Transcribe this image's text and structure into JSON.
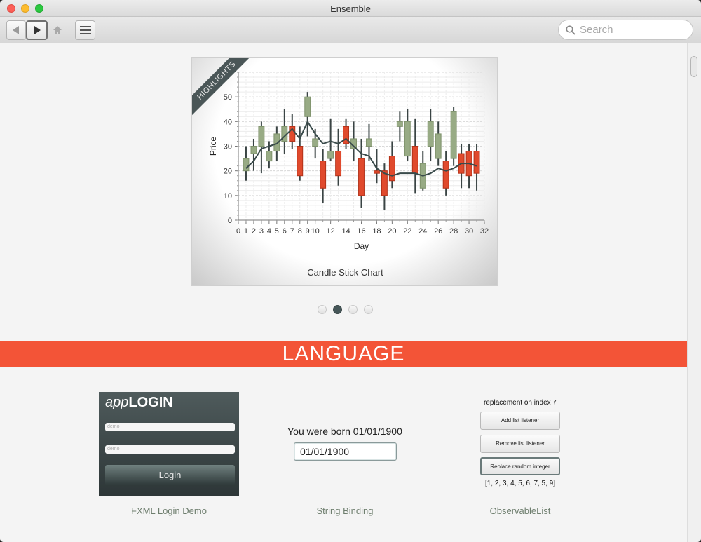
{
  "window": {
    "title": "Ensemble"
  },
  "toolbar": {
    "back_icon": "back-icon",
    "forward_icon": "forward-icon",
    "home_icon": "home-icon",
    "menu_icon": "menu-icon",
    "search_placeholder": "Search"
  },
  "carousel": {
    "ribbon": "HIGHLIGHTS",
    "caption": "Candle Stick Chart",
    "pages": 4,
    "active_page": 2
  },
  "chart_data": {
    "type": "candlestick",
    "xlabel": "Day",
    "ylabel": "Price",
    "xlim": [
      0,
      32
    ],
    "ylim": [
      0,
      60
    ],
    "xticks": [
      0,
      1,
      2,
      3,
      4,
      5,
      6,
      7,
      8,
      9,
      10,
      12,
      14,
      16,
      18,
      20,
      22,
      24,
      26,
      28,
      30,
      32
    ],
    "yticks": [
      0,
      10,
      20,
      30,
      40,
      50
    ],
    "colors": {
      "bull": "#98ab85",
      "bear": "#e04a2d",
      "line": "#3a4b4b"
    },
    "candles": [
      {
        "x": 1,
        "open": 20,
        "close": 25,
        "high": 30,
        "low": 16
      },
      {
        "x": 2,
        "open": 27,
        "close": 30,
        "high": 33,
        "low": 20
      },
      {
        "x": 3,
        "open": 30,
        "close": 38,
        "high": 40,
        "low": 19
      },
      {
        "x": 4,
        "open": 24,
        "close": 28,
        "high": 32,
        "low": 21
      },
      {
        "x": 5,
        "open": 28,
        "close": 35,
        "high": 38,
        "low": 24
      },
      {
        "x": 6,
        "open": 32,
        "close": 38,
        "high": 45,
        "low": 27
      },
      {
        "x": 7,
        "open": 38,
        "close": 32,
        "high": 43,
        "low": 29
      },
      {
        "x": 8,
        "open": 30,
        "close": 18,
        "high": 38,
        "low": 16
      },
      {
        "x": 9,
        "open": 42,
        "close": 50,
        "high": 52,
        "low": 34
      },
      {
        "x": 10,
        "open": 30,
        "close": 33,
        "high": 37,
        "low": 25
      },
      {
        "x": 11,
        "open": 24,
        "close": 13,
        "high": 29,
        "low": 7
      },
      {
        "x": 12,
        "open": 25,
        "close": 28,
        "high": 41,
        "low": 24
      },
      {
        "x": 13,
        "open": 28,
        "close": 18,
        "high": 37,
        "low": 14
      },
      {
        "x": 14,
        "open": 38,
        "close": 31,
        "high": 41,
        "low": 29
      },
      {
        "x": 15,
        "open": 29,
        "close": 33,
        "high": 40,
        "low": 24
      },
      {
        "x": 16,
        "open": 25,
        "close": 10,
        "high": 33,
        "low": 5
      },
      {
        "x": 17,
        "open": 30,
        "close": 33,
        "high": 39,
        "low": 24
      },
      {
        "x": 18,
        "open": 20,
        "close": 19,
        "high": 29,
        "low": 15
      },
      {
        "x": 19,
        "open": 20,
        "close": 10,
        "high": 23,
        "low": 4
      },
      {
        "x": 20,
        "open": 26,
        "close": 16,
        "high": 32,
        "low": 13
      },
      {
        "x": 21,
        "open": 38,
        "close": 40,
        "high": 44,
        "low": 32
      },
      {
        "x": 22,
        "open": 26,
        "close": 40,
        "high": 45,
        "low": 24
      },
      {
        "x": 23,
        "open": 30,
        "close": 19,
        "high": 41,
        "low": 11
      },
      {
        "x": 24,
        "open": 13,
        "close": 23,
        "high": 28,
        "low": 12
      },
      {
        "x": 25,
        "open": 30,
        "close": 40,
        "high": 45,
        "low": 24
      },
      {
        "x": 26,
        "open": 25,
        "close": 35,
        "high": 40,
        "low": 22
      },
      {
        "x": 27,
        "open": 24,
        "close": 13,
        "high": 28,
        "low": 10
      },
      {
        "x": 28,
        "open": 25,
        "close": 44,
        "high": 46,
        "low": 22
      },
      {
        "x": 29,
        "open": 27,
        "close": 19,
        "high": 31,
        "low": 13
      },
      {
        "x": 30,
        "open": 28,
        "close": 18,
        "high": 31,
        "low": 13
      },
      {
        "x": 31,
        "open": 28,
        "close": 19,
        "high": 31,
        "low": 12
      }
    ],
    "average": [
      [
        1,
        21
      ],
      [
        2,
        24
      ],
      [
        3,
        29
      ],
      [
        4,
        30
      ],
      [
        5,
        31
      ],
      [
        6,
        34
      ],
      [
        7,
        37
      ],
      [
        8,
        33
      ],
      [
        9,
        40
      ],
      [
        10,
        35
      ],
      [
        11,
        31
      ],
      [
        12,
        32
      ],
      [
        13,
        31
      ],
      [
        14,
        33
      ],
      [
        15,
        30
      ],
      [
        16,
        27
      ],
      [
        17,
        26
      ],
      [
        18,
        21
      ],
      [
        19,
        19
      ],
      [
        20,
        18
      ],
      [
        21,
        19
      ],
      [
        22,
        19
      ],
      [
        23,
        19
      ],
      [
        24,
        18
      ],
      [
        25,
        19
      ],
      [
        26,
        21
      ],
      [
        27,
        20
      ],
      [
        28,
        21
      ],
      [
        29,
        23
      ],
      [
        30,
        23
      ],
      [
        31,
        22
      ]
    ]
  },
  "section": {
    "title": "LANGUAGE"
  },
  "login_demo": {
    "brand_prefix": "app",
    "brand_suffix": "LOGIN",
    "user_value": "demo",
    "password_value": "demo",
    "button_label": "Login",
    "caption": "FXML Login Demo"
  },
  "string_binding": {
    "born_text": "You were born 01/01/1900",
    "date_value": "01/01/1900",
    "caption": "String Binding"
  },
  "observable_list": {
    "status": "replacement on index 7",
    "add_label": "Add list listener",
    "remove_label": "Remove list listener",
    "replace_label": "Replace random integer",
    "list_text": "[1, 2, 3, 4, 5, 6, 7, 5, 9]",
    "caption": "ObservableList"
  }
}
